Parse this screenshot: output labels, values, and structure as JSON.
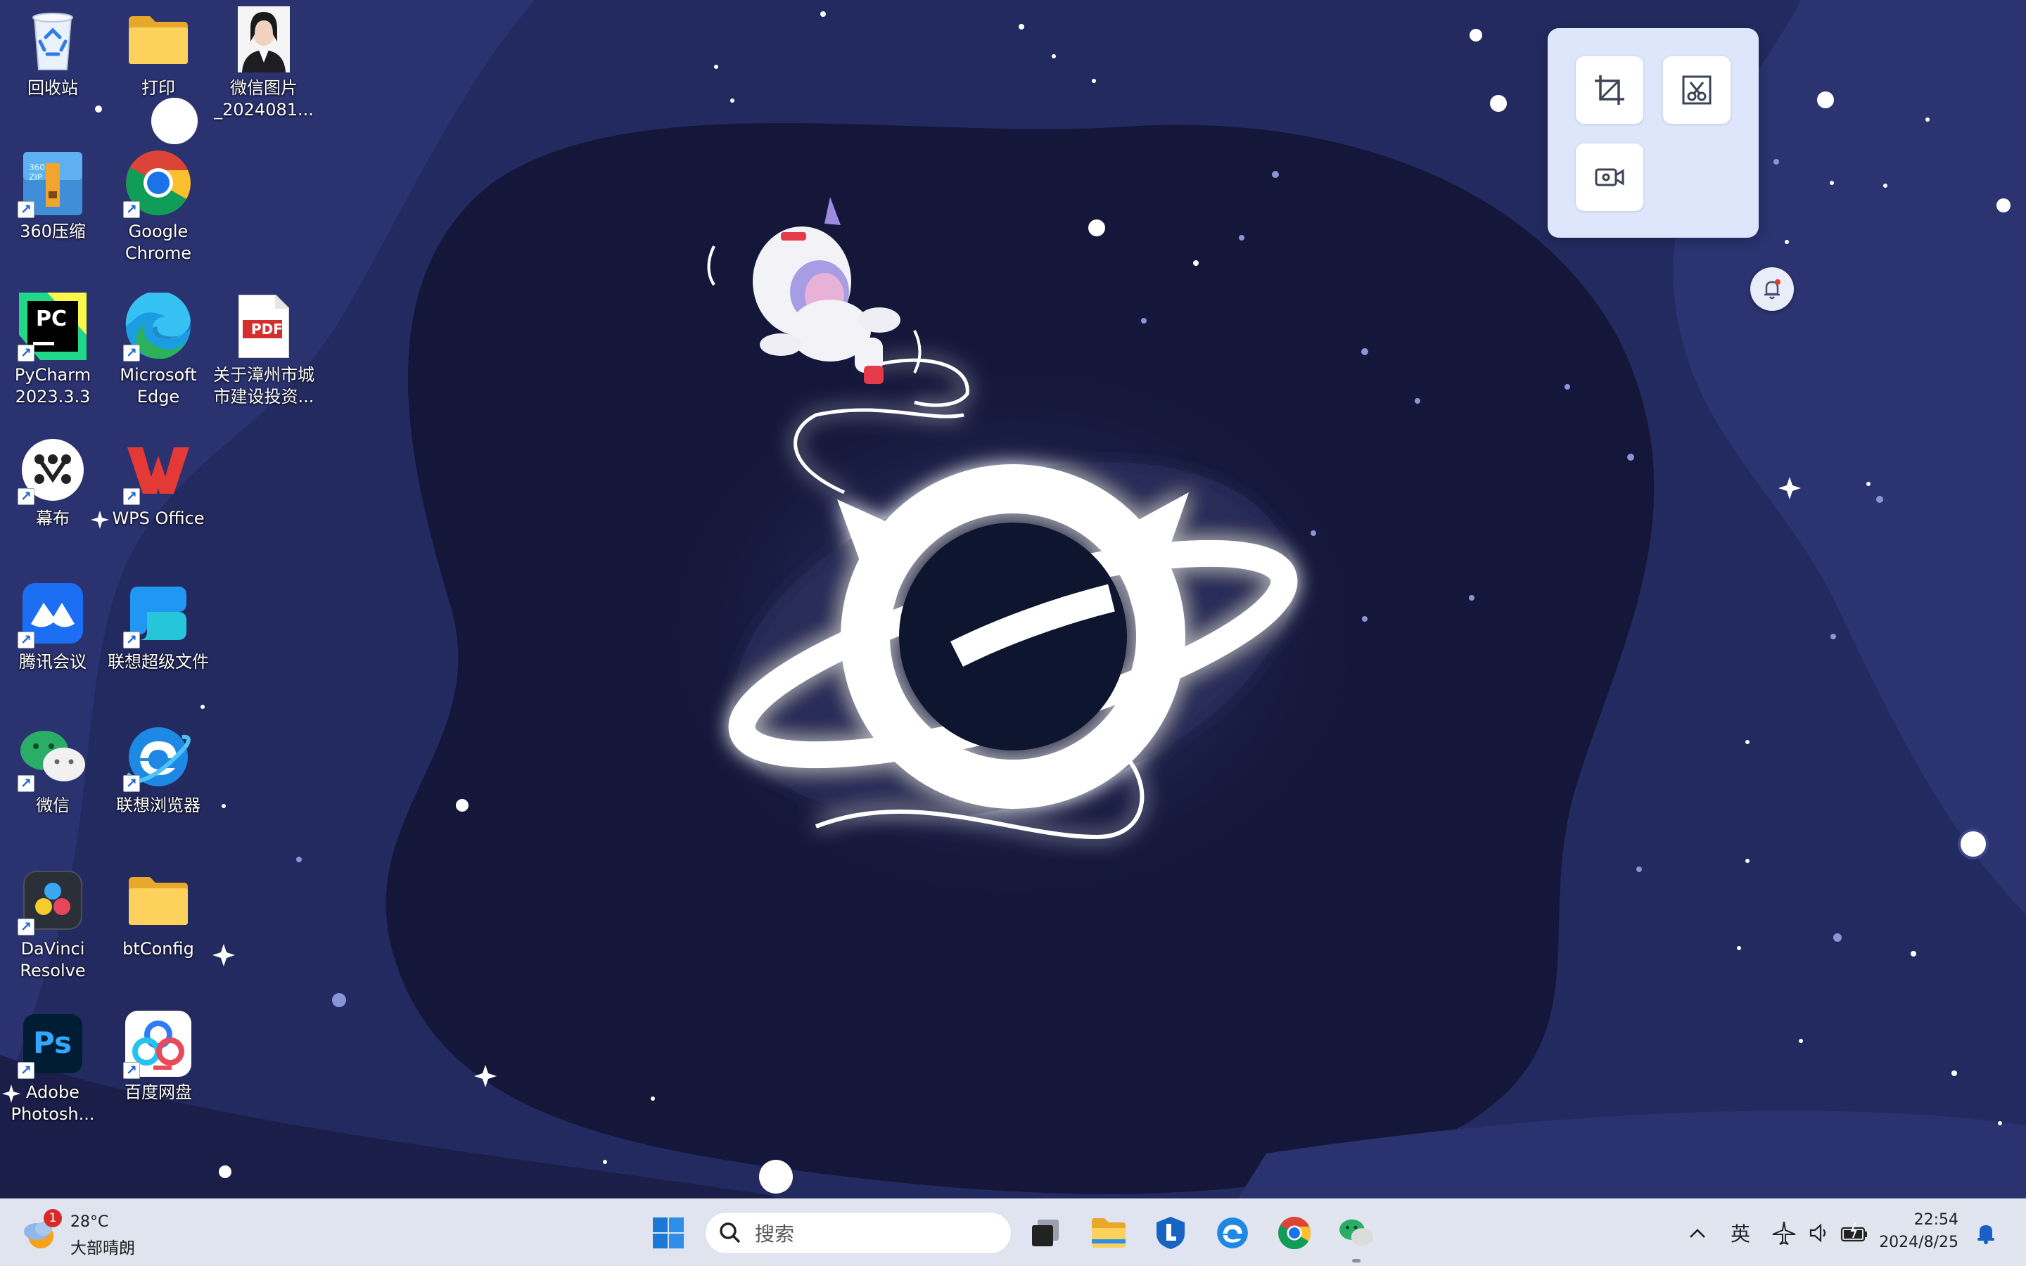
{
  "desktop": {
    "icons": [
      {
        "label": "回收站",
        "icon": "recycle-bin-icon"
      },
      {
        "label": "打印",
        "icon": "folder-icon"
      },
      {
        "label": "微信图片\n_2024081...",
        "icon": "photo-thumbnail"
      },
      {
        "label": "360压缩",
        "icon": "360zip-icon"
      },
      {
        "label": "Google\nChrome",
        "icon": "chrome-icon"
      },
      {
        "label": "PyCharm\n2023.3.3",
        "icon": "pycharm-icon"
      },
      {
        "label": "Microsoft\nEdge",
        "icon": "edge-icon"
      },
      {
        "label": "关于漳州市城\n市建设投资...",
        "icon": "pdf-icon",
        "badge": "PDF"
      },
      {
        "label": "幕布",
        "icon": "mubu-icon"
      },
      {
        "label": "WPS Office",
        "icon": "wps-icon"
      },
      {
        "label": "腾讯会议",
        "icon": "tencent-meeting-icon"
      },
      {
        "label": "联想超级文件",
        "icon": "lenovo-files-icon"
      },
      {
        "label": "微信",
        "icon": "wechat-icon"
      },
      {
        "label": "联想浏览器",
        "icon": "lenovo-browser-icon"
      },
      {
        "label": "DaVinci\nResolve",
        "icon": "davinci-icon"
      },
      {
        "label": "btConfig",
        "icon": "folder-icon"
      },
      {
        "label": "Adobe\nPhotosh...",
        "icon": "photoshop-icon",
        "badge": "Ps"
      },
      {
        "label": "百度网盘",
        "icon": "baidu-netdisk-icon"
      }
    ],
    "pycharm_badge": "PC",
    "zip_badge": "360\nZIP"
  },
  "snip_widget": {
    "buttons": [
      "crop-capture-icon",
      "scissors-capture-icon",
      "screen-record-icon"
    ]
  },
  "taskbar": {
    "weather": {
      "temp": "28°C",
      "desc": "大部晴朗",
      "alert_count": "1"
    },
    "search_placeholder": "搜索",
    "apps": [
      "windows-start-icon",
      "task-view-icon",
      "file-explorer-icon",
      "lenovo-app-icon",
      "lenovo-browser-icon",
      "chrome-icon",
      "wechat-icon"
    ],
    "tray": {
      "show_hidden": "^",
      "ime": "英"
    },
    "clock": {
      "time": "22:54",
      "date": "2024/8/25"
    }
  },
  "colors": {
    "wallpaper_dark": "#14173a",
    "wallpaper_mid": "#222a5e",
    "taskbar": "#e8ecf6",
    "accent": "#0067c0"
  }
}
